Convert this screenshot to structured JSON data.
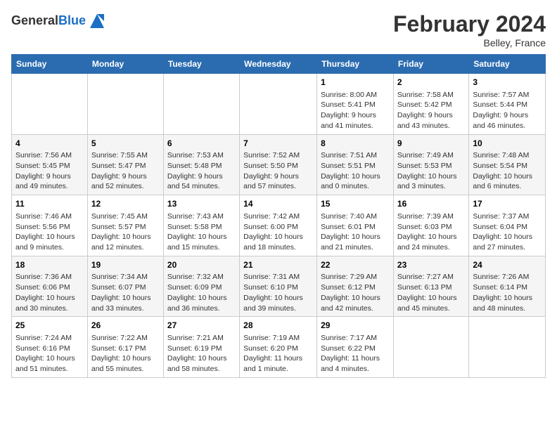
{
  "header": {
    "logo_line1": "General",
    "logo_line2": "Blue",
    "title": "February 2024",
    "subtitle": "Belley, France"
  },
  "columns": [
    "Sunday",
    "Monday",
    "Tuesday",
    "Wednesday",
    "Thursday",
    "Friday",
    "Saturday"
  ],
  "weeks": [
    [
      {
        "day": "",
        "info": ""
      },
      {
        "day": "",
        "info": ""
      },
      {
        "day": "",
        "info": ""
      },
      {
        "day": "",
        "info": ""
      },
      {
        "day": "1",
        "info": "Sunrise: 8:00 AM\nSunset: 5:41 PM\nDaylight: 9 hours\nand 41 minutes."
      },
      {
        "day": "2",
        "info": "Sunrise: 7:58 AM\nSunset: 5:42 PM\nDaylight: 9 hours\nand 43 minutes."
      },
      {
        "day": "3",
        "info": "Sunrise: 7:57 AM\nSunset: 5:44 PM\nDaylight: 9 hours\nand 46 minutes."
      }
    ],
    [
      {
        "day": "4",
        "info": "Sunrise: 7:56 AM\nSunset: 5:45 PM\nDaylight: 9 hours\nand 49 minutes."
      },
      {
        "day": "5",
        "info": "Sunrise: 7:55 AM\nSunset: 5:47 PM\nDaylight: 9 hours\nand 52 minutes."
      },
      {
        "day": "6",
        "info": "Sunrise: 7:53 AM\nSunset: 5:48 PM\nDaylight: 9 hours\nand 54 minutes."
      },
      {
        "day": "7",
        "info": "Sunrise: 7:52 AM\nSunset: 5:50 PM\nDaylight: 9 hours\nand 57 minutes."
      },
      {
        "day": "8",
        "info": "Sunrise: 7:51 AM\nSunset: 5:51 PM\nDaylight: 10 hours\nand 0 minutes."
      },
      {
        "day": "9",
        "info": "Sunrise: 7:49 AM\nSunset: 5:53 PM\nDaylight: 10 hours\nand 3 minutes."
      },
      {
        "day": "10",
        "info": "Sunrise: 7:48 AM\nSunset: 5:54 PM\nDaylight: 10 hours\nand 6 minutes."
      }
    ],
    [
      {
        "day": "11",
        "info": "Sunrise: 7:46 AM\nSunset: 5:56 PM\nDaylight: 10 hours\nand 9 minutes."
      },
      {
        "day": "12",
        "info": "Sunrise: 7:45 AM\nSunset: 5:57 PM\nDaylight: 10 hours\nand 12 minutes."
      },
      {
        "day": "13",
        "info": "Sunrise: 7:43 AM\nSunset: 5:58 PM\nDaylight: 10 hours\nand 15 minutes."
      },
      {
        "day": "14",
        "info": "Sunrise: 7:42 AM\nSunset: 6:00 PM\nDaylight: 10 hours\nand 18 minutes."
      },
      {
        "day": "15",
        "info": "Sunrise: 7:40 AM\nSunset: 6:01 PM\nDaylight: 10 hours\nand 21 minutes."
      },
      {
        "day": "16",
        "info": "Sunrise: 7:39 AM\nSunset: 6:03 PM\nDaylight: 10 hours\nand 24 minutes."
      },
      {
        "day": "17",
        "info": "Sunrise: 7:37 AM\nSunset: 6:04 PM\nDaylight: 10 hours\nand 27 minutes."
      }
    ],
    [
      {
        "day": "18",
        "info": "Sunrise: 7:36 AM\nSunset: 6:06 PM\nDaylight: 10 hours\nand 30 minutes."
      },
      {
        "day": "19",
        "info": "Sunrise: 7:34 AM\nSunset: 6:07 PM\nDaylight: 10 hours\nand 33 minutes."
      },
      {
        "day": "20",
        "info": "Sunrise: 7:32 AM\nSunset: 6:09 PM\nDaylight: 10 hours\nand 36 minutes."
      },
      {
        "day": "21",
        "info": "Sunrise: 7:31 AM\nSunset: 6:10 PM\nDaylight: 10 hours\nand 39 minutes."
      },
      {
        "day": "22",
        "info": "Sunrise: 7:29 AM\nSunset: 6:12 PM\nDaylight: 10 hours\nand 42 minutes."
      },
      {
        "day": "23",
        "info": "Sunrise: 7:27 AM\nSunset: 6:13 PM\nDaylight: 10 hours\nand 45 minutes."
      },
      {
        "day": "24",
        "info": "Sunrise: 7:26 AM\nSunset: 6:14 PM\nDaylight: 10 hours\nand 48 minutes."
      }
    ],
    [
      {
        "day": "25",
        "info": "Sunrise: 7:24 AM\nSunset: 6:16 PM\nDaylight: 10 hours\nand 51 minutes."
      },
      {
        "day": "26",
        "info": "Sunrise: 7:22 AM\nSunset: 6:17 PM\nDaylight: 10 hours\nand 55 minutes."
      },
      {
        "day": "27",
        "info": "Sunrise: 7:21 AM\nSunset: 6:19 PM\nDaylight: 10 hours\nand 58 minutes."
      },
      {
        "day": "28",
        "info": "Sunrise: 7:19 AM\nSunset: 6:20 PM\nDaylight: 11 hours\nand 1 minute."
      },
      {
        "day": "29",
        "info": "Sunrise: 7:17 AM\nSunset: 6:22 PM\nDaylight: 11 hours\nand 4 minutes."
      },
      {
        "day": "",
        "info": ""
      },
      {
        "day": "",
        "info": ""
      }
    ]
  ]
}
